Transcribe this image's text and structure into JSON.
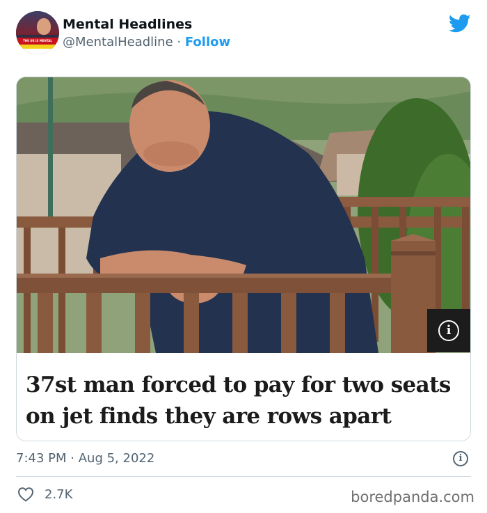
{
  "author": {
    "name": "Mental Headlines",
    "handle": "@MentalHeadline",
    "separator": "·",
    "follow_label": "Follow",
    "avatar_text": "THE UK IS MENTAL"
  },
  "brand_icon": "twitter-bird-icon",
  "card": {
    "image_subject": "man leaning on wooden fence",
    "info_icon": "info-icon",
    "headline_line1": "37st man forced to pay for two seats",
    "headline_line2": "on jet finds they are rows apart"
  },
  "meta": {
    "time": "7:43 PM",
    "separator": "·",
    "date": "Aug 5, 2022",
    "info_icon": "info-icon"
  },
  "actions": {
    "like_icon": "heart-icon",
    "like_count": "2.7K"
  },
  "watermark": "boredpanda.com",
  "colors": {
    "link_blue": "#1d9bf0",
    "secondary_text": "#536471",
    "border": "#cfd9de"
  }
}
